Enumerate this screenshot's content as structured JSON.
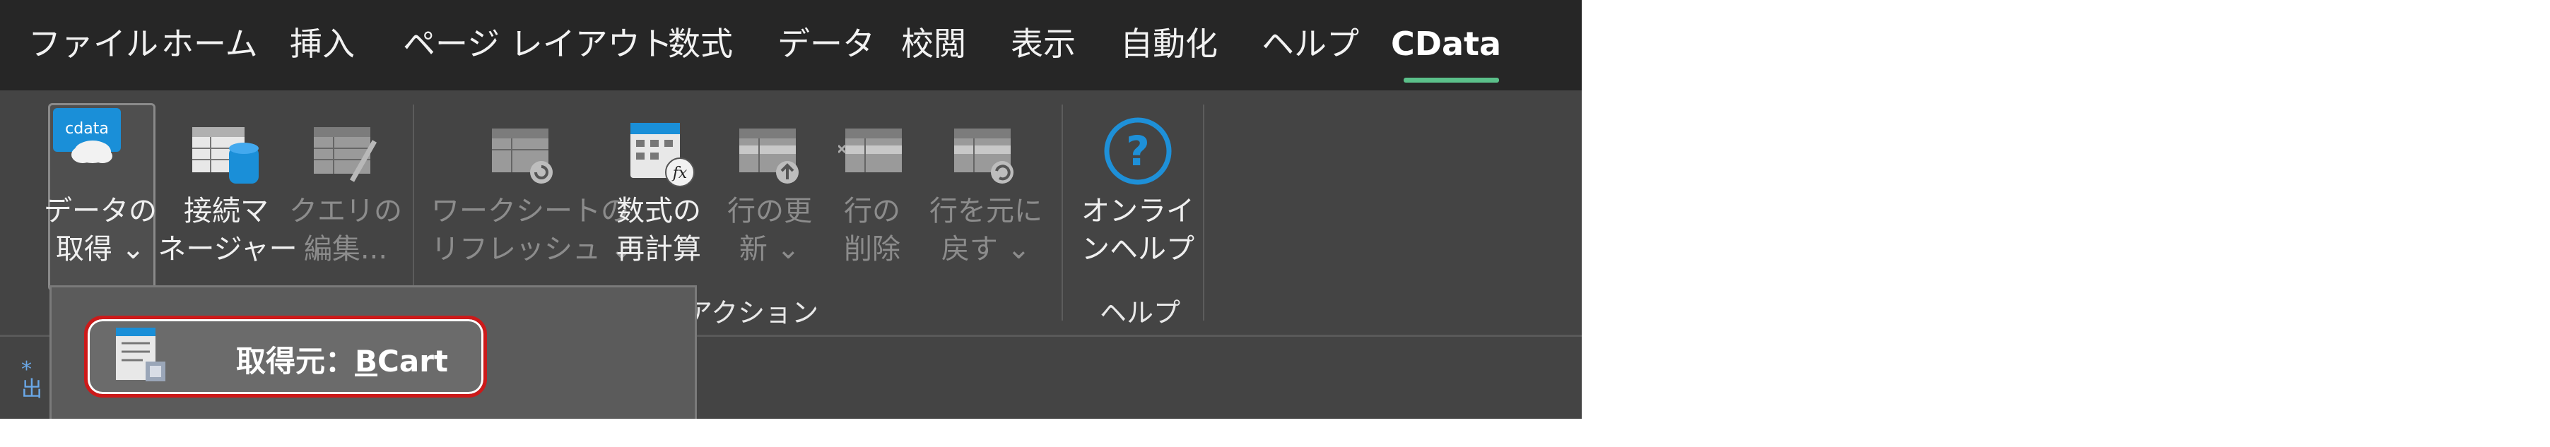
{
  "menu": {
    "tabs": [
      {
        "label": "ファイル"
      },
      {
        "label": "ホーム"
      },
      {
        "label": "挿入"
      },
      {
        "label": "ページ レイアウト"
      },
      {
        "label": "数式"
      },
      {
        "label": "データ"
      },
      {
        "label": "校閲"
      },
      {
        "label": "表示"
      },
      {
        "label": "自動化"
      },
      {
        "label": "ヘルプ"
      },
      {
        "label": "CData"
      }
    ],
    "active_tab": "CData"
  },
  "ribbon": {
    "get_data": {
      "line1": "データの",
      "line2": "取得 ⌄"
    },
    "connection_manager": {
      "line1": "接続マ",
      "line2": "ネージャー"
    },
    "edit_query": {
      "line1": "クエリの",
      "line2": "編集..."
    },
    "refresh_sheet": {
      "line1": "ワークシートの",
      "line2": "リフレッシュ ⌄"
    },
    "recalc": {
      "line1": "数式の",
      "line2": "再計算"
    },
    "update_row": {
      "line1": "行の更",
      "line2": "新 ⌄"
    },
    "delete_row": {
      "line1": "行の",
      "line2": "削除"
    },
    "revert_row": {
      "line1": "行を元に",
      "line2": "戻す ⌄"
    },
    "online_help": {
      "line1": "オンライ",
      "line2": "ンヘルプ"
    },
    "group_actions": "アクション",
    "group_help": "ヘルプ"
  },
  "dropdown": {
    "item_prefix": "取得元：",
    "item_source_initial": "B",
    "item_source_rest": "Cart"
  },
  "colors": {
    "ribbon_bg": "#444444",
    "menubar_bg": "#262626",
    "accent_underline": "#5bc08a",
    "highlight_border": "#cc1a1a",
    "help_icon": "#1e90d8"
  }
}
